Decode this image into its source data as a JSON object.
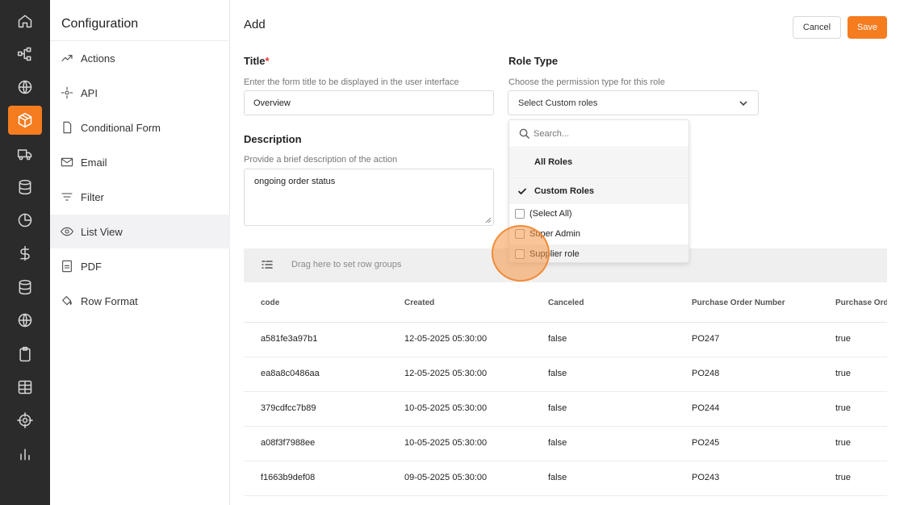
{
  "theme": {
    "accent": "#f57c1f",
    "rail_bg": "#2b2b2b"
  },
  "rail": {
    "items": [
      {
        "icon": "home-icon"
      },
      {
        "icon": "workflow-icon"
      },
      {
        "icon": "globe-icon"
      },
      {
        "icon": "box-icon",
        "active": true
      },
      {
        "icon": "truck-icon"
      },
      {
        "icon": "database-icon"
      },
      {
        "icon": "pie-chart-icon"
      },
      {
        "icon": "dollar-icon"
      },
      {
        "icon": "database-icon"
      },
      {
        "icon": "globe-icon"
      },
      {
        "icon": "clipboard-icon"
      },
      {
        "icon": "grid-table-icon"
      },
      {
        "icon": "target-icon"
      },
      {
        "icon": "bar-chart-icon"
      }
    ]
  },
  "config": {
    "title": "Configuration",
    "items": [
      {
        "label": "Actions",
        "icon": "trend-icon"
      },
      {
        "label": "API",
        "icon": "api-icon"
      },
      {
        "label": "Conditional Form",
        "icon": "file-icon"
      },
      {
        "label": "Email",
        "icon": "mail-icon"
      },
      {
        "label": "Filter",
        "icon": "filter-icon"
      },
      {
        "label": "List View",
        "icon": "eye-icon",
        "active": true
      },
      {
        "label": "PDF",
        "icon": "pdf-icon"
      },
      {
        "label": "Row Format",
        "icon": "paint-bucket-icon"
      }
    ]
  },
  "main": {
    "title": "Add",
    "cancel_label": "Cancel",
    "save_label": "Save",
    "title_field": {
      "label": "Title",
      "required_mark": "*",
      "help": "Enter the form title to be displayed in the user interface",
      "value": "Overview"
    },
    "description_field": {
      "label": "Description",
      "help": "Provide a brief description of the action",
      "value": "ongoing order status"
    },
    "role_type": {
      "label": "Role Type",
      "help": "Choose the permission type for this role",
      "selected": "Select Custom roles"
    }
  },
  "dropdown": {
    "search_placeholder": "Search...",
    "options": [
      {
        "label": "All Roles",
        "checked": false
      },
      {
        "label": "Custom Roles",
        "checked": true
      }
    ],
    "role_items": [
      {
        "label": "(Select All)"
      },
      {
        "label": "Super Admin"
      },
      {
        "label": "Supplier role"
      }
    ]
  },
  "grid": {
    "group_bar_text": "Drag here to set row groups",
    "columns": [
      "code",
      "Created",
      "Canceled",
      "Purchase Order Number",
      "Purchase Ord"
    ],
    "rows": [
      [
        "a581fe3a97b1",
        "12-05-2025 05:30:00",
        "false",
        "PO247",
        "true"
      ],
      [
        "ea8a8c0486aa",
        "12-05-2025 05:30:00",
        "false",
        "PO248",
        "true"
      ],
      [
        "379cdfcc7b89",
        "10-05-2025 05:30:00",
        "false",
        "PO244",
        "true"
      ],
      [
        "a08f3f7988ee",
        "10-05-2025 05:30:00",
        "false",
        "PO245",
        "true"
      ],
      [
        "f1663b9def08",
        "09-05-2025 05:30:00",
        "false",
        "PO243",
        "true"
      ]
    ]
  }
}
